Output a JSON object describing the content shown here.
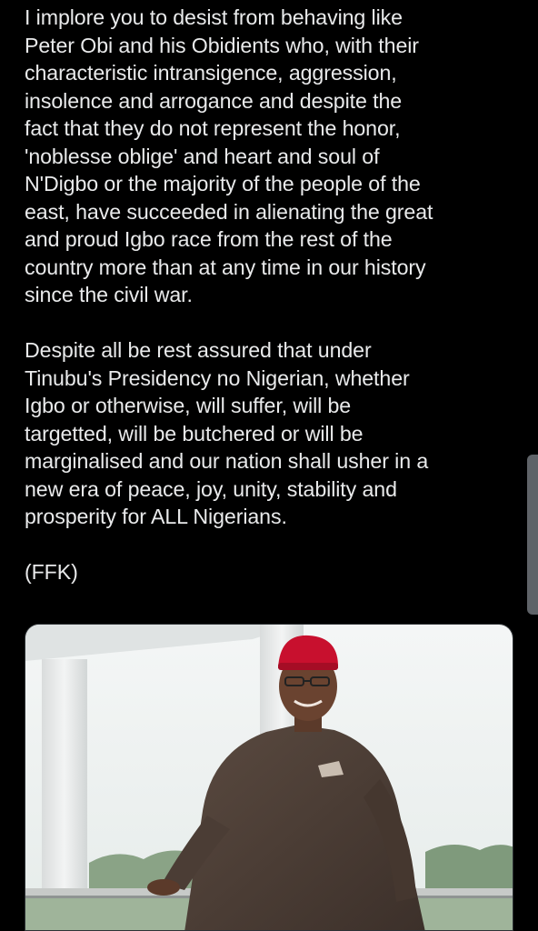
{
  "post": {
    "paragraphs": [
      "I implore you to desist from behaving like\nPeter Obi and his Obidients who, with their\ncharacteristic intransigence, aggression,\ninsolence and arrogance and despite the\nfact that they do not represent the honor,\n'noblesse oblige' and heart and soul of\nN'Digbo or the majority of the people of the\neast, have succeeded in alienating the great\nand proud Igbo race from the rest of the\ncountry more than at any time in our history\nsince the civil war.",
      "Despite all be rest assured that under\nTinubu's Presidency no Nigerian, whether\nIgbo or otherwise, will suffer, will be\ntargetted, will be butchered or will be\nmarginalised and our nation shall usher in a\nnew era of peace, joy, unity, stability and\nprosperity for ALL Nigerians."
    ],
    "signature": "(FFK)"
  },
  "media": {
    "subject": "man in red cap and brown kaftan on balcony",
    "icon": "photo"
  },
  "colors": {
    "background": "#000000",
    "text": "#e9eaeb",
    "scrollbar": "#5f6368",
    "cap": "#c8102e",
    "kaftan": "#4a3b33"
  }
}
